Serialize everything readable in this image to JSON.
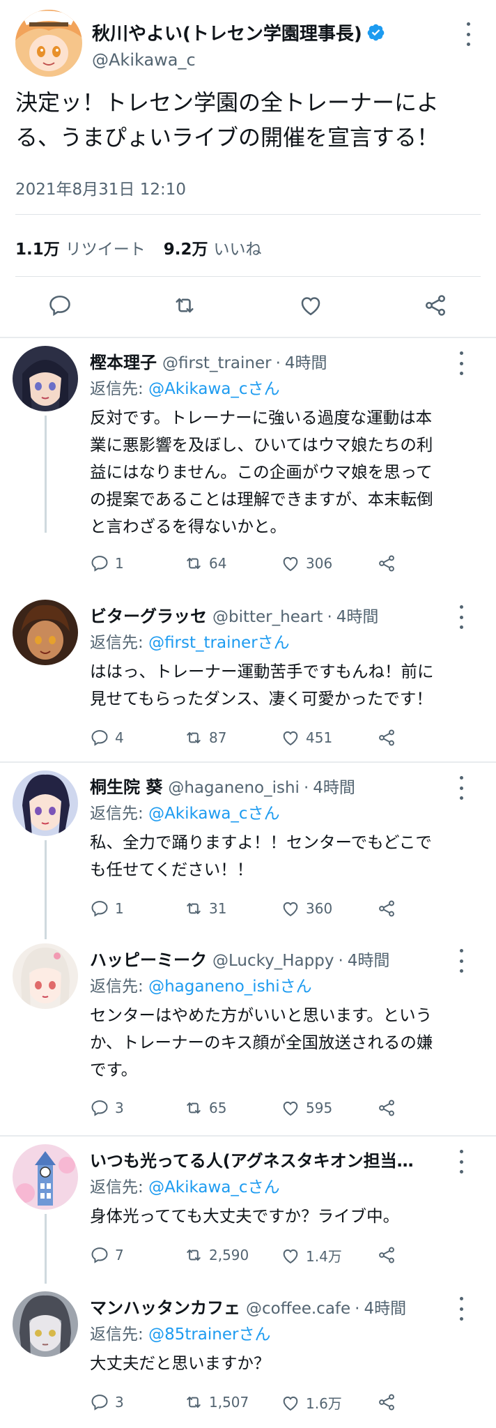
{
  "main_tweet": {
    "display_name": "秋川やよい(トレセン学園理事長)",
    "handle": "@Akikawa_c",
    "text_line1": "決定ッ！トレセン学園の全トレーナーによ",
    "text_line2": "る、うまぴょいライブの開催を宣言する！",
    "timestamp": "2021年8月31日 12:10",
    "retweet_count": "1.1万",
    "retweet_label": "リツイート",
    "like_count": "9.2万",
    "like_label": "いいね",
    "actions": [
      "reply-icon",
      "retweet-icon",
      "like-icon",
      "share-icon"
    ]
  },
  "replies": [
    {
      "name": "樫本理子",
      "handle": "@first_trainer",
      "sep": "·",
      "time": "4時間",
      "reply_to_prefix": "返信先: ",
      "reply_to": "@Akikawa_cさん",
      "lines": [
        "反対です。トレーナーに強いる過度な運動は本",
        "業に悪影響を及ぼし、ひいてはウマ娘たちの利",
        "益にはなりません。この企画がウマ娘を思って",
        "の提案であることは理解できますが、本末転倒",
        "と言わざるを得ないかと。"
      ],
      "replies": "1",
      "retweets": "64",
      "likes": "306"
    },
    {
      "name": "ビターグラッセ",
      "handle": "@bitter_heart",
      "sep": "·",
      "time": "4時間",
      "reply_to_prefix": "返信先: ",
      "reply_to": "@first_trainerさん",
      "lines": [
        "ははっ、トレーナー運動苦手ですもんね！前に",
        "見せてもらったダンス、凄く可愛かったです！"
      ],
      "replies": "4",
      "retweets": "87",
      "likes": "451"
    },
    {
      "name": "桐生院 葵",
      "handle": "@haganeno_ishi",
      "sep": "·",
      "time": "4時間",
      "reply_to_prefix": "返信先: ",
      "reply_to": "@Akikawa_cさん",
      "lines": [
        "私、全力で踊りますよ！！センターでもどこで",
        "も任せてください！！"
      ],
      "replies": "1",
      "retweets": "31",
      "likes": "360"
    },
    {
      "name": "ハッピーミーク",
      "handle": "@Lucky_Happy",
      "sep": "·",
      "time": "4時間",
      "reply_to_prefix": "返信先: ",
      "reply_to": "@haganeno_ishiさん",
      "lines": [
        "センターはやめた方がいいと思います。という",
        "か、トレーナーのキス顔が全国放送されるの嫌",
        "です。"
      ],
      "replies": "3",
      "retweets": "65",
      "likes": "595"
    },
    {
      "name": "いつも光ってる人(アグネスタキオン担当…",
      "handle": "",
      "sep": "",
      "time": "",
      "reply_to_prefix": "返信先: ",
      "reply_to": "@Akikawa_cさん",
      "lines": [
        "身体光ってても大丈夫ですか？ライブ中。"
      ],
      "replies": "7",
      "retweets": "2,590",
      "likes": "1.4万"
    },
    {
      "name": "マンハッタンカフェ",
      "handle": "@coffee.cafe",
      "sep": "·",
      "time": "4時間",
      "reply_to_prefix": "返信先: ",
      "reply_to": "@85trainerさん",
      "lines": [
        "大丈夫だと思いますか？"
      ],
      "replies": "3",
      "retweets": "1,507",
      "likes": "1.6万"
    }
  ],
  "colors": {
    "text": "#0f1419",
    "secondary": "#536471",
    "link": "#1d9bf0",
    "verified": "#1d9bf0",
    "divider": "#dfe3e7"
  }
}
